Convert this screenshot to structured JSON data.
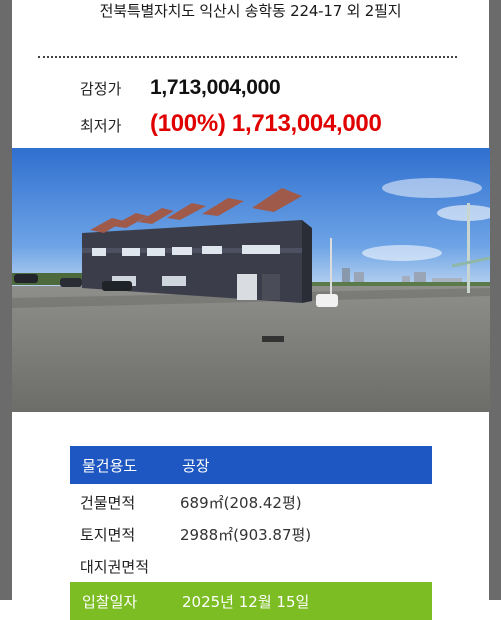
{
  "address": "전북특별자치도 익산시 송학동 224-17 외 2필지",
  "prices": {
    "appraisal_label": "감정가",
    "appraisal_value": "1,713,004,000",
    "minimum_label": "최저가",
    "minimum_value": "(100%) 1,713,004,000"
  },
  "photo": {
    "subject": "warehouse-building-photo",
    "sky_color": "#4a86d6",
    "ground_color": "#7d7d7a"
  },
  "details": {
    "usage_label": "물건용도",
    "usage_value": "공장",
    "building_area_label": "건물면적",
    "building_area_value": "689㎡(208.42평)",
    "land_area_label": "토지면적",
    "land_area_value": "2988㎡(903.87평)",
    "land_right_label": "대지권면적",
    "land_right_value": "",
    "auction_date_label": "입찰일자",
    "auction_date_value": "2025년 12월 15일"
  },
  "colors": {
    "price_red": "#e00000",
    "usage_bar_blue": "#1e57c1",
    "date_bar_green": "#7bbd22"
  }
}
